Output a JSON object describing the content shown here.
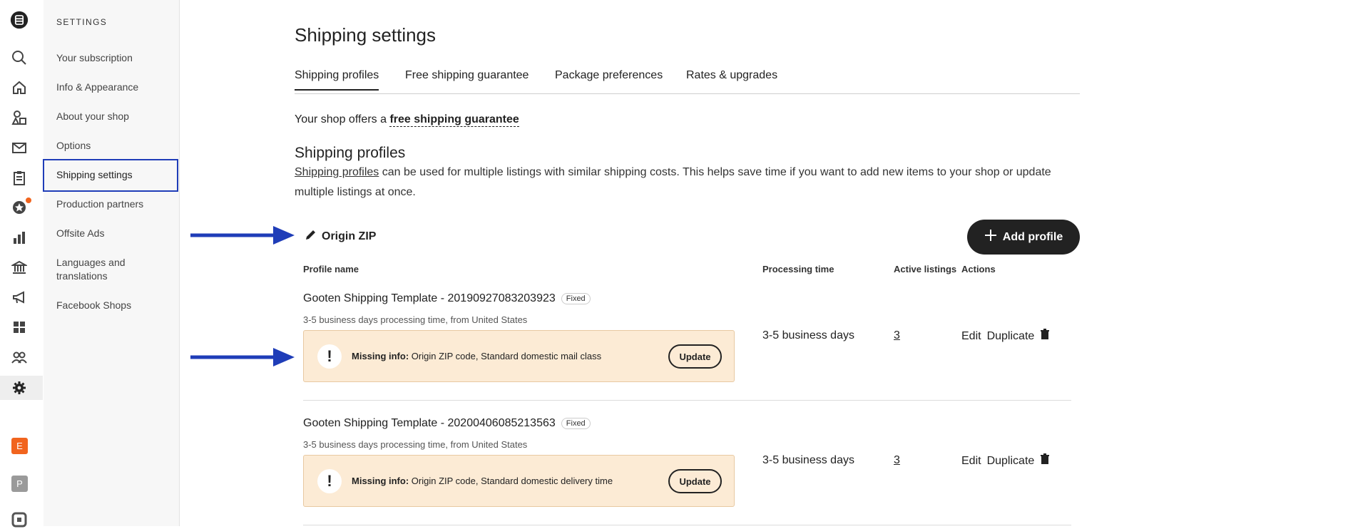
{
  "rail": {
    "icons": [
      "logo-icon",
      "search-icon",
      "home-icon",
      "shapes-icon",
      "mail-icon",
      "clipboard-icon",
      "star-badge-icon",
      "bar-chart-icon",
      "bank-icon",
      "megaphone-icon",
      "grid-icon",
      "people-icon",
      "gear-icon"
    ],
    "shops": [
      {
        "letter": "E",
        "color": "#f1641e"
      },
      {
        "letter": "P",
        "color": "#9a9a9a"
      }
    ]
  },
  "sidebar": {
    "heading": "SETTINGS",
    "items": [
      {
        "label": "Your subscription"
      },
      {
        "label": "Info & Appearance"
      },
      {
        "label": "About your shop"
      },
      {
        "label": "Options"
      },
      {
        "label": "Shipping settings"
      },
      {
        "label": "Production partners"
      },
      {
        "label": "Offsite Ads"
      },
      {
        "label": "Languages and translations"
      },
      {
        "label": "Facebook Shops"
      }
    ]
  },
  "page": {
    "title": "Shipping settings",
    "tabs": [
      {
        "label": "Shipping profiles"
      },
      {
        "label": "Free shipping guarantee"
      },
      {
        "label": "Package preferences"
      },
      {
        "label": "Rates & upgrades"
      }
    ],
    "guarantee_prefix": "Your shop offers a ",
    "guarantee_link": "free shipping guarantee",
    "section_title": "Shipping profiles",
    "desc_link": "Shipping profiles",
    "desc_rest": " can be used for multiple listings with similar shipping costs. This helps save time if you want to add new items to your shop or update multiple listings at once.",
    "origin_zip": "Origin ZIP",
    "add_profile": "Add profile",
    "columns": {
      "name": "Profile name",
      "time": "Processing time",
      "listings": "Active listings",
      "actions": "Actions"
    },
    "profiles": [
      {
        "name": "Gooten Shipping Template - 20190927083203923",
        "badge": "Fixed",
        "sub": "3-5 business days processing time, from United States",
        "warn_label": "Missing info:",
        "warn_text": " Origin ZIP code, Standard domestic mail class",
        "update": "Update",
        "processing": "3-5 business days",
        "listings": "3",
        "edit": "Edit",
        "duplicate": "Duplicate"
      },
      {
        "name": "Gooten Shipping Template - 20200406085213563",
        "badge": "Fixed",
        "sub": "3-5 business days processing time, from United States",
        "warn_label": "Missing info:",
        "warn_text": " Origin ZIP code, Standard domestic delivery time",
        "update": "Update",
        "processing": "3-5 business days",
        "listings": "3",
        "edit": "Edit",
        "duplicate": "Duplicate"
      }
    ]
  },
  "colors": {
    "annotation_arrow": "#1f3db8",
    "warning_bg": "#fcebd5",
    "button_dark": "#222222"
  }
}
